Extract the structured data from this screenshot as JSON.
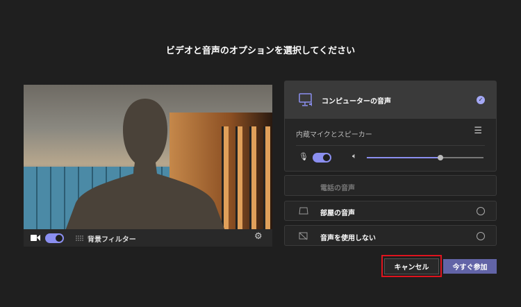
{
  "title": "ビデオと音声のオプションを選択してください",
  "video": {
    "camera_on": true,
    "background_filter_label": "背景フィルター"
  },
  "audio_options": {
    "computer": {
      "label": "コンピューターの音声",
      "selected": true,
      "device": "内蔵マイクとスピーカー",
      "mic_on": true,
      "volume": 0.63
    },
    "phone": {
      "label": "電話の音声"
    },
    "room": {
      "label": "部屋の音声",
      "selected": false
    },
    "none": {
      "label": "音声を使用しない",
      "selected": false
    }
  },
  "buttons": {
    "cancel": "キャンセル",
    "join": "今すぐ参加"
  },
  "colors": {
    "accent": "#8b8ff0",
    "join_bg": "#6264a7",
    "highlight": "#e0141e"
  }
}
